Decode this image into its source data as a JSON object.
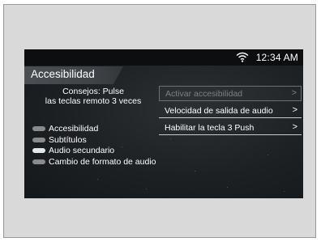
{
  "status": {
    "time": "12:34 AM",
    "wifi_icon": "wifi-icon"
  },
  "header": {
    "title": "Accesibilidad"
  },
  "tip": {
    "line1": "Consejos: Pulse",
    "line2": "las teclas remoto 3 veces"
  },
  "legend": [
    {
      "label": "Accesibilidad",
      "color": "#8a8a8a"
    },
    {
      "label": "Subtítulos",
      "color": "#8a8a8a"
    },
    {
      "label": "Audio secundario",
      "color": "#e6e6e6"
    },
    {
      "label": "Cambio de formato de audio",
      "color": "#8a8a8a"
    }
  ],
  "menu": [
    {
      "label": "Activar accesibilidad",
      "disabled": true,
      "chevron": ">"
    },
    {
      "label": "Velocidad de salida de audio",
      "disabled": false,
      "chevron": ">"
    },
    {
      "label": "Habilitar la tecla 3 Push",
      "disabled": false,
      "chevron": ">"
    }
  ]
}
